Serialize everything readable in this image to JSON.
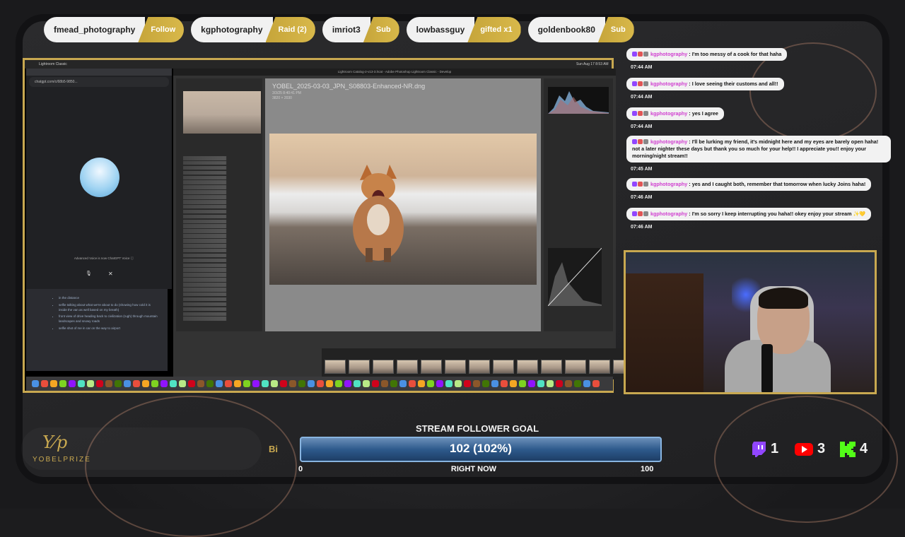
{
  "alerts": [
    {
      "name": "fmead_photography",
      "action": "Follow"
    },
    {
      "name": "kgphotography",
      "action": "Raid (2)"
    },
    {
      "name": "imriot3",
      "action": "Sub"
    },
    {
      "name": "lowbassguy",
      "action": "gifted x1"
    },
    {
      "name": "goldenbook80",
      "action": "Sub"
    }
  ],
  "screen": {
    "lightroom": {
      "window_title": "Lightroom Catalog-2-v13-3.lrcat - Adobe Photoshop Lightroom Classic - Develop",
      "filename": "YOBEL_2025-03-03_JPN_S08803-Enhanced-NR.dng",
      "meta_line1": "3/3/25 8:40:41 PM",
      "meta_line2": "3820 × 2030"
    },
    "chatgpt": {
      "url": "chatgpt.com/c/68b5-9850...",
      "voice_text": "Advanced Voice is now ChatGPT Voice ⓘ"
    },
    "notes": [
      "in the distance",
      "selfie talking about what we're about to do (showing how cold it is inside the van as well based on my breath)",
      "front view of drive heading back to civilization (rugh) through mountain landscapes and snowy roads",
      "selfie shot of me in car on the way to airport"
    ]
  },
  "chat": {
    "messages": [
      {
        "user": "kgphotography",
        "text": "I'm too messy of a cook for that haha",
        "time": "07:44 AM"
      },
      {
        "user": "kgphotography",
        "text": "I love seeing their customs and all!!",
        "time": "07:44 AM"
      },
      {
        "user": "kgphotography",
        "text": "yes I agree",
        "time": "07:44 AM"
      },
      {
        "user": "kgphotography",
        "text": "I'll be lurking my friend, it's midnight here and my eyes are barely open haha! not a later nighter these days but thank you so much for your help!! I appreciate you!! enjoy your morning/night stream!!",
        "time": "07:45 AM"
      },
      {
        "user": "kgphotography",
        "text": "yes and I caught both, remember that tomorrow when lucky Joins haha!",
        "time": "07:46 AM"
      },
      {
        "user": "kgphotography",
        "text": "I'm so sorry I keep interrupting you haha!! okey enjoy your stream ✨💛",
        "time": "07:46 AM"
      }
    ]
  },
  "goal": {
    "title": "STREAM FOLLOWER GOAL",
    "value": "102 (102%)",
    "progress": 1.0,
    "start": "0",
    "label": "RIGHT NOW",
    "end": "100"
  },
  "brand": {
    "name": "YOBELPRIZE",
    "ticker": "Bi"
  },
  "socials": [
    {
      "platform": "twitch-icon",
      "count": "1",
      "color": "#9146ff"
    },
    {
      "platform": "youtube-icon",
      "count": "3",
      "color": "#ff0000"
    },
    {
      "platform": "kick-icon",
      "count": "4",
      "color": "#53fc18"
    }
  ],
  "colors": {
    "accent_gold": "#c8a850",
    "chat_user": "#d040d0",
    "goal_blue": "#2e5a8c"
  }
}
